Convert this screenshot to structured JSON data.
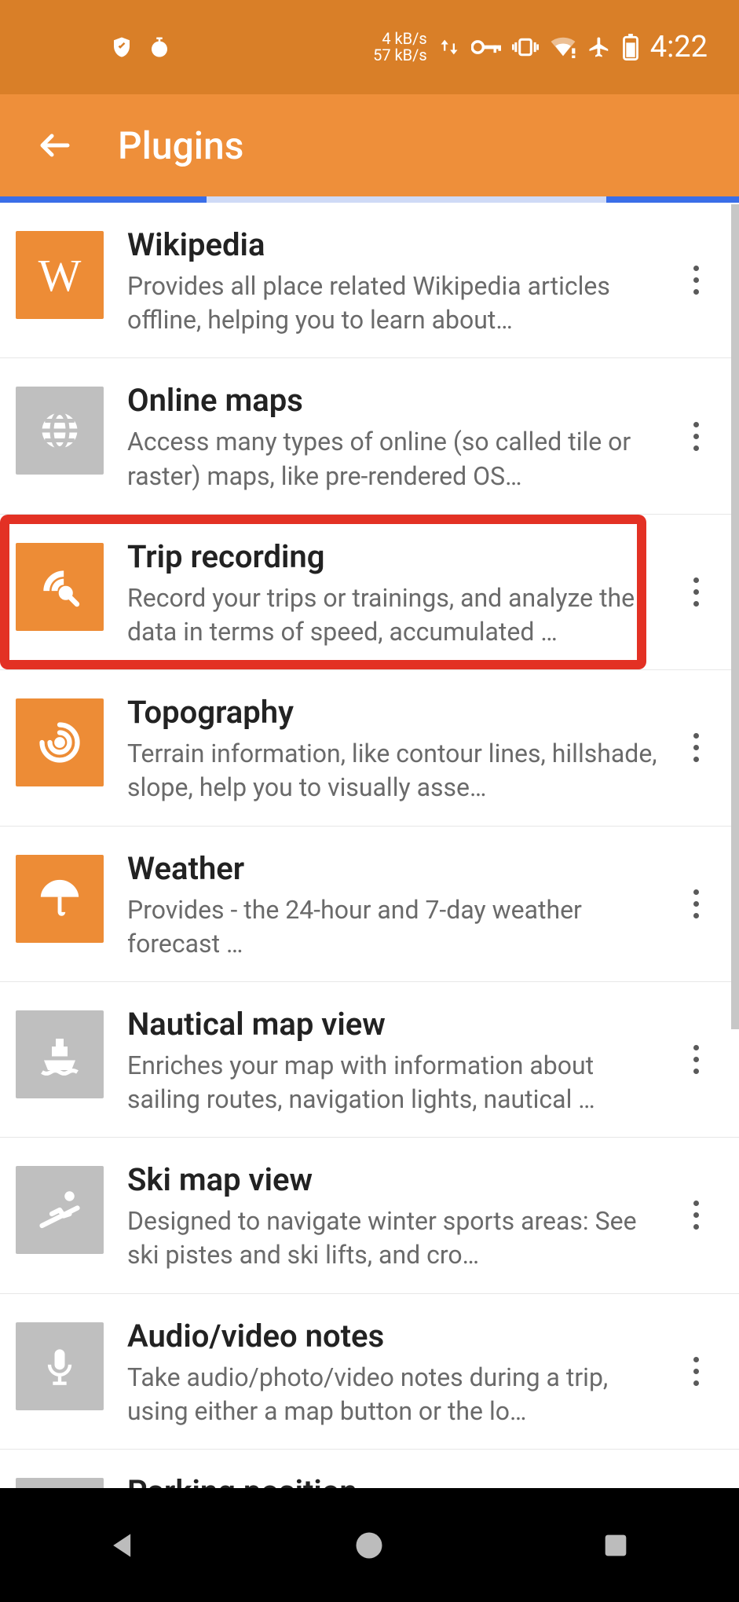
{
  "status": {
    "rate_up": "4 kB/s",
    "rate_down": "57 kB/s",
    "time": "4:22"
  },
  "header": {
    "title": "Plugins"
  },
  "plugins": [
    {
      "key": "wikipedia",
      "title": "Wikipedia",
      "desc": "Provides all place related Wikipedia articles offline, helping you to learn about…",
      "icon": "letter-W",
      "style": "orange",
      "highlight": false
    },
    {
      "key": "onlinemaps",
      "title": "Online maps",
      "desc": "Access many types of online (so called tile or raster) maps, like pre-rendered OS…",
      "icon": "globe",
      "style": "gray",
      "highlight": false
    },
    {
      "key": "trip",
      "title": "Trip recording",
      "desc": "Record your trips or trainings, and analyze the data in terms of speed, accumulated …",
      "icon": "satellite",
      "style": "orange",
      "highlight": true
    },
    {
      "key": "topo",
      "title": "Topography",
      "desc": "Terrain information, like contour lines, hillshade, slope, help you to visually asse…",
      "icon": "contour",
      "style": "orange",
      "highlight": false
    },
    {
      "key": "weather",
      "title": "Weather",
      "desc": "Provides\n- the 24-hour and 7-day weather forecast …",
      "icon": "umbrella",
      "style": "orange",
      "highlight": false
    },
    {
      "key": "nautical",
      "title": "Nautical map view",
      "desc": "Enriches your map with information about sailing routes, navigation lights, nautical …",
      "icon": "boat",
      "style": "gray",
      "highlight": false
    },
    {
      "key": "ski",
      "title": "Ski map view",
      "desc": "Designed to navigate winter sports areas: See ski pistes and ski lifts, and cro…",
      "icon": "ski",
      "style": "gray",
      "highlight": false
    },
    {
      "key": "av",
      "title": "Audio/video notes",
      "desc": "Take audio/photo/video notes during a trip, using either a map button or the lo…",
      "icon": "mic",
      "style": "gray",
      "highlight": false
    },
    {
      "key": "parking",
      "title": "Parking position",
      "desc": "",
      "icon": "parking",
      "style": "gray",
      "highlight": false
    }
  ]
}
